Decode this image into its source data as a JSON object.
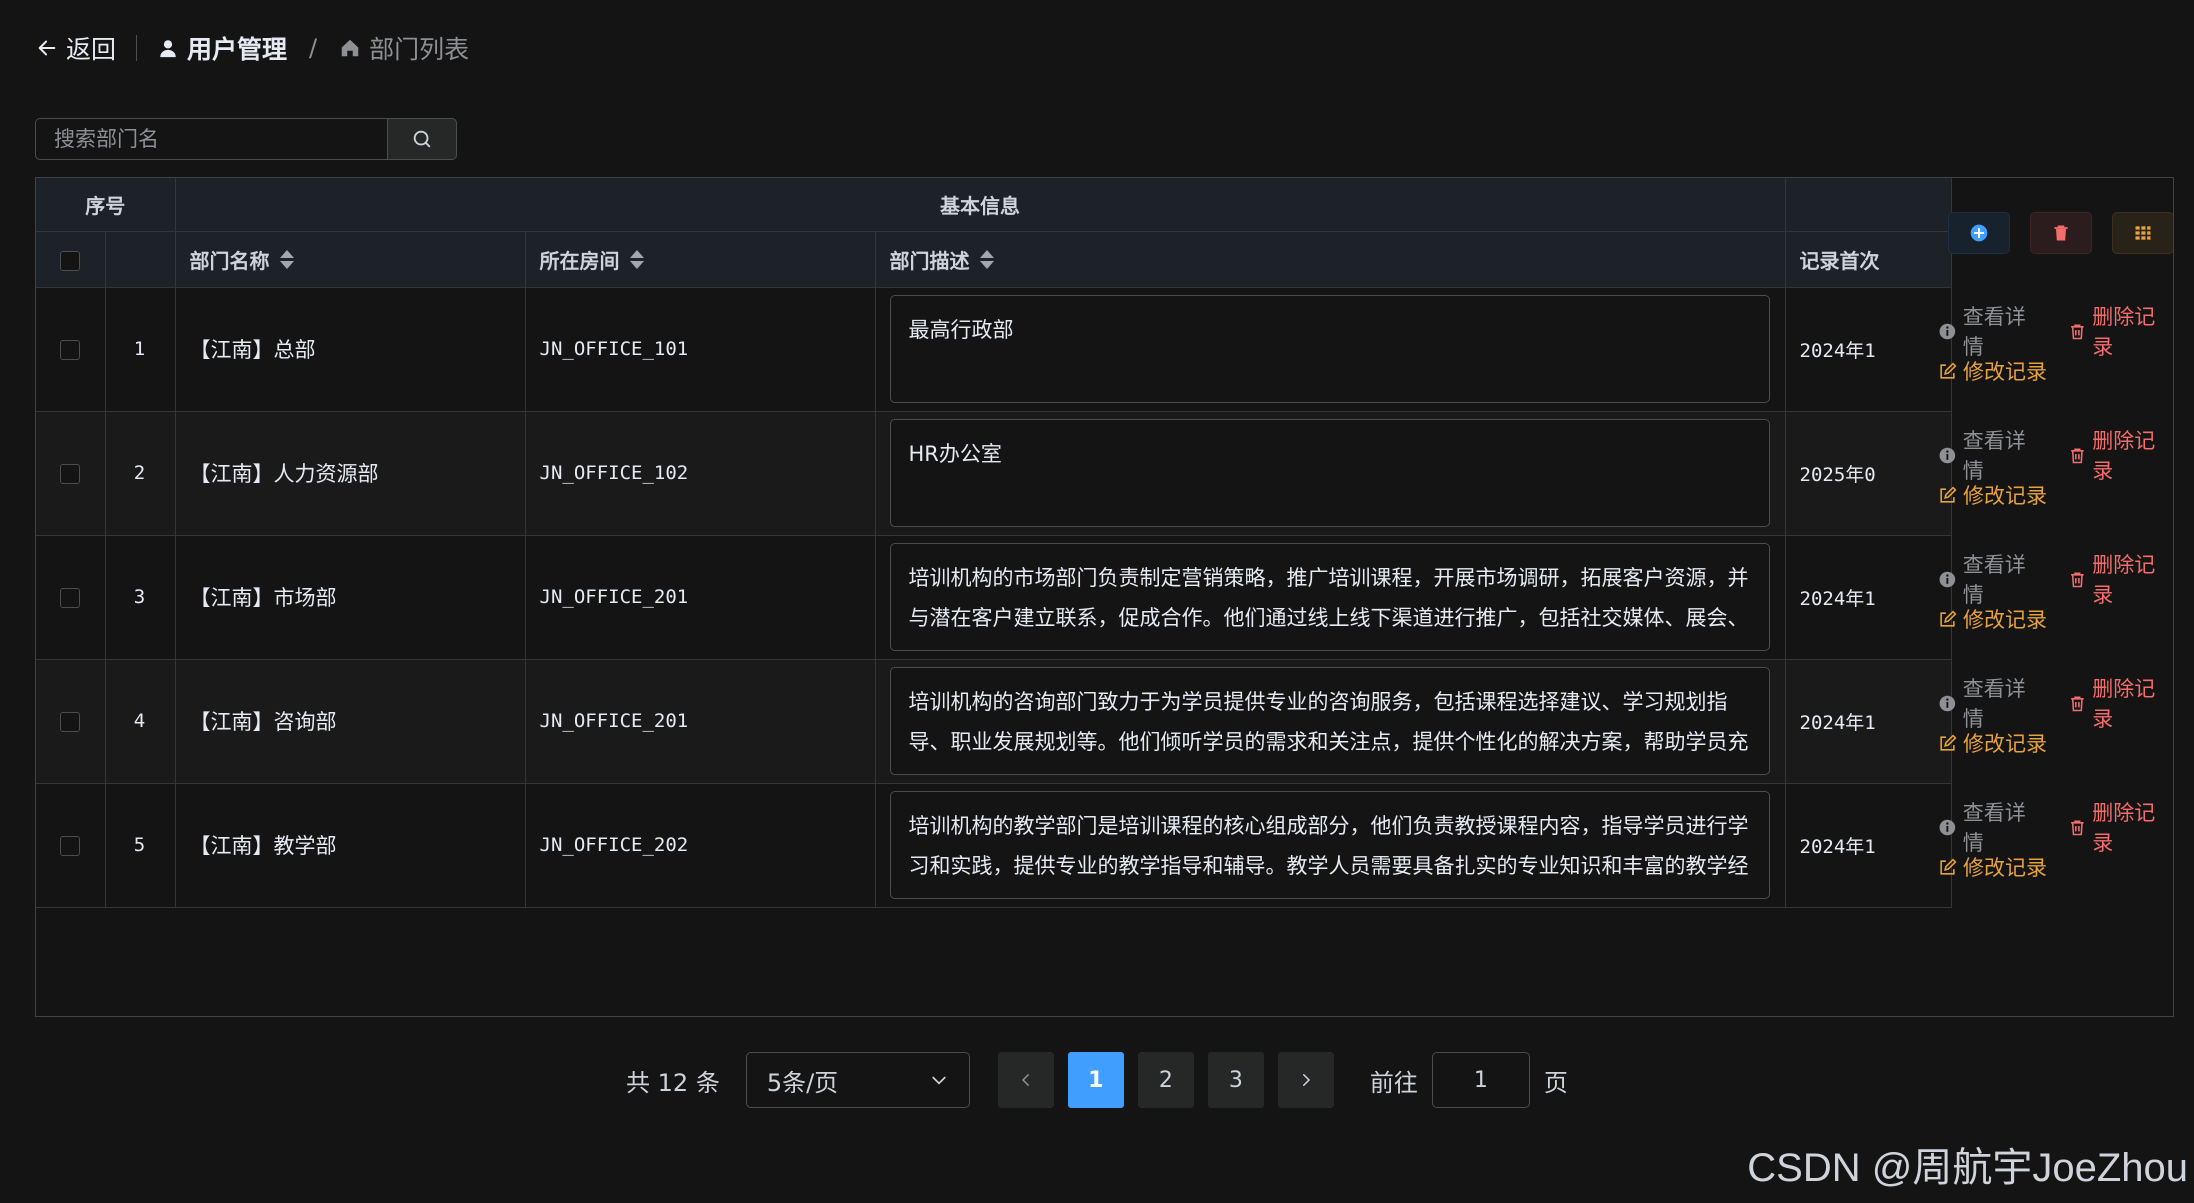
{
  "topbar": {
    "back_label": "返回",
    "crumbs": [
      "用户管理",
      "部门列表"
    ],
    "separator": "/"
  },
  "search": {
    "placeholder": "搜索部门名"
  },
  "table": {
    "group_headers": {
      "index": "序号",
      "basic": "基本信息"
    },
    "columns": {
      "name": "部门名称",
      "room": "所在房间",
      "desc": "部门描述",
      "created": "记录首次"
    },
    "rows": [
      {
        "idx": "1",
        "name": "【江南】总部",
        "room": "JN_OFFICE_101",
        "desc": "最高行政部",
        "created": "2024年1"
      },
      {
        "idx": "2",
        "name": "【江南】人力资源部",
        "room": "JN_OFFICE_102",
        "desc": "HR办公室",
        "created": "2025年0"
      },
      {
        "idx": "3",
        "name": "【江南】市场部",
        "room": "JN_OFFICE_201",
        "desc": "培训机构的市场部门负责制定营销策略，推广培训课程，开展市场调研，拓展客户资源，并与潜在客户建立联系，促成合作。他们通过线上线下渠道进行推广，包括社交媒体、展会、",
        "created": "2024年1"
      },
      {
        "idx": "4",
        "name": "【江南】咨询部",
        "room": "JN_OFFICE_201",
        "desc": "培训机构的咨询部门致力于为学员提供专业的咨询服务，包括课程选择建议、学习规划指导、职业发展规划等。他们倾听学员的需求和关注点，提供个性化的解决方案，帮助学员充",
        "created": "2024年1"
      },
      {
        "idx": "5",
        "name": "【江南】教学部",
        "room": "JN_OFFICE_202",
        "desc": "培训机构的教学部门是培训课程的核心组成部分，他们负责教授课程内容，指导学员进行学习和实践，提供专业的教学指导和辅导。教学人员需要具备扎实的专业知识和丰富的教学经",
        "created": "2024年1"
      }
    ],
    "actions": {
      "view": "查看详情",
      "delete": "删除记录",
      "edit": "修改记录"
    }
  },
  "pagination": {
    "total_prefix": "共",
    "total": "12",
    "total_suffix": "条",
    "page_size": "5条/页",
    "pages": [
      "1",
      "2",
      "3"
    ],
    "current": "1",
    "goto_prefix": "前往",
    "goto_value": "1",
    "goto_suffix": "页"
  },
  "watermark": "CSDN @周航宇JoeZhou",
  "colors": {
    "primary": "#409eff",
    "danger": "#f56c6c",
    "warning": "#e6a23c",
    "background": "#141414"
  }
}
